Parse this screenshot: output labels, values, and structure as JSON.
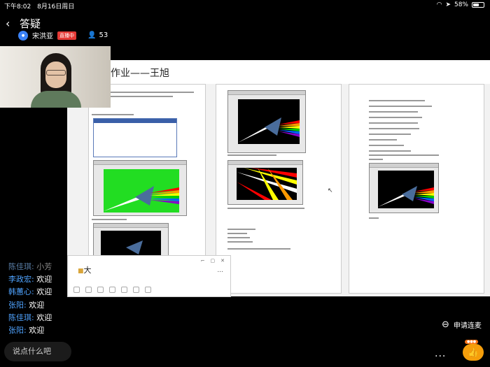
{
  "status": {
    "time": "下午8:02",
    "date": "8月16日周日",
    "battery": "58%",
    "battery_level": 0.58
  },
  "header": {
    "back_icon": "chevron-left-icon",
    "title": "答疑",
    "host_name": "宋洪亚",
    "live_badge": "直播中",
    "viewer_count": "53"
  },
  "screen": {
    "doc_title": "作业——王旭"
  },
  "popup": {
    "text": "大",
    "more": "..."
  },
  "chat": [
    {
      "user": "陈佳琪:",
      "text": "小芳",
      "faded": true
    },
    {
      "user": "李政宏:",
      "text": "欢迎",
      "faded": false
    },
    {
      "user": "韩蕙心:",
      "text": "欢迎",
      "faded": false
    },
    {
      "user": "张阳:",
      "text": "欢迎",
      "faded": false
    },
    {
      "user": "陈佳琪:",
      "text": "欢迎",
      "faded": false
    },
    {
      "user": "张阳:",
      "text": "欢迎",
      "faded": false
    }
  ],
  "input": {
    "placeholder": "说点什么吧"
  },
  "actions": {
    "apply_mic": "申请连麦",
    "more": "..."
  },
  "colors": {
    "username": "#4fa3ff",
    "live_red": "#e53935",
    "like_orange": "#f59e0b"
  }
}
